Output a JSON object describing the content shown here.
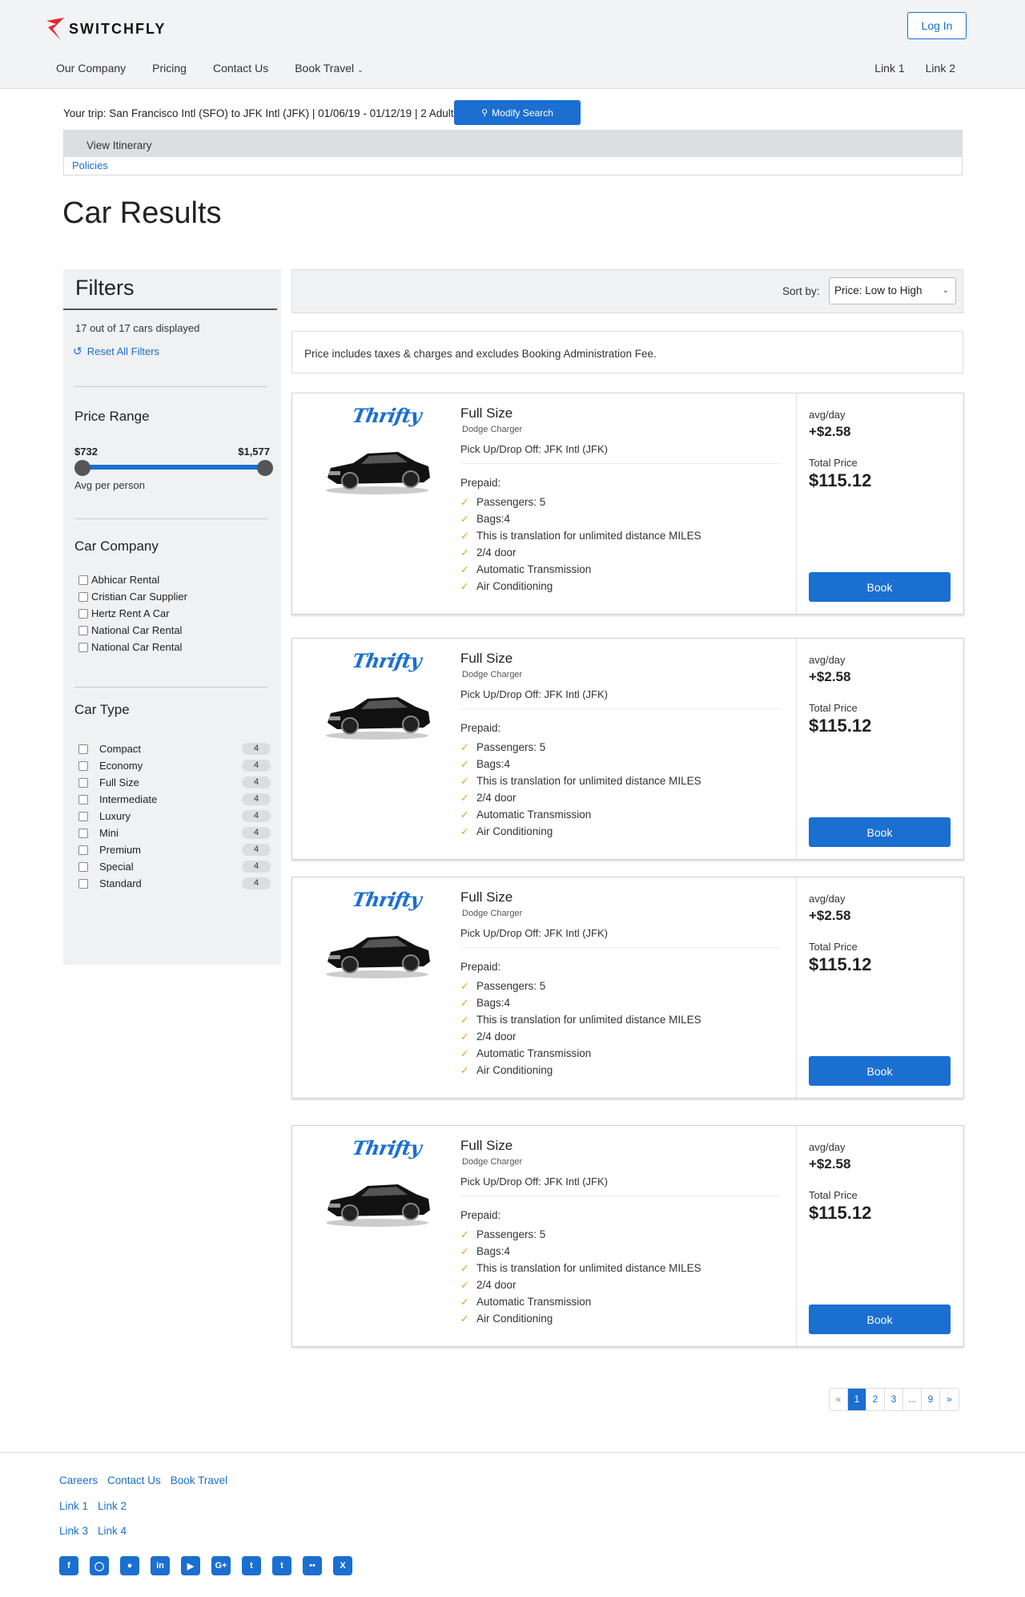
{
  "header": {
    "logo_text": "SWITCHFLY",
    "login_label": "Log In",
    "nav": [
      "Our Company",
      "Pricing",
      "Contact Us",
      "Book Travel"
    ],
    "nav_right": [
      "Link 1",
      "Link 2"
    ]
  },
  "trip": {
    "summary": "Your trip: San Francisco Intl (SFO) to JFK Intl (JFK) | 01/06/19 - 01/12/19 | 2 Adults",
    "modify_label": "Modify Search",
    "itinerary_label": "View Itinerary",
    "policies_label": "Policies"
  },
  "page_title": "Car Results",
  "filters": {
    "title": "Filters",
    "count": "17 out of 17 cars displayed",
    "reset": "Reset All Filters",
    "price_range": {
      "title": "Price Range",
      "min": "$732",
      "max": "$1,577",
      "note": "Avg per person"
    },
    "car_company": {
      "title": "Car Company",
      "items": [
        "Abhicar Rental",
        "Cristian Car Supplier",
        "Hertz Rent A Car",
        "National Car Rental",
        "National Car Rental"
      ]
    },
    "car_type": {
      "title": "Car Type",
      "items": [
        {
          "label": "Compact",
          "count": "4"
        },
        {
          "label": "Economy",
          "count": "4"
        },
        {
          "label": "Full Size",
          "count": "4"
        },
        {
          "label": "Intermediate",
          "count": "4"
        },
        {
          "label": "Luxury",
          "count": "4"
        },
        {
          "label": "Mini",
          "count": "4"
        },
        {
          "label": "Premium",
          "count": "4"
        },
        {
          "label": "Special",
          "count": "4"
        },
        {
          "label": "Standard",
          "count": "4"
        }
      ]
    }
  },
  "sort": {
    "label": "Sort by:",
    "selected": "Price: Low to High"
  },
  "price_note": "Price includes taxes & charges and excludes Booking Administration Fee.",
  "cars": [
    {
      "vendor": "Thrifty",
      "title": "Full Size",
      "model": "Dodge Charger",
      "pickup": "Pick Up/Drop Off: JFK Intl (JFK)",
      "prepaid": "Prepaid:",
      "features": [
        "Passengers: 5",
        "Bags:4",
        "This is translation for unlimited distance MILES",
        "2/4 door",
        "Automatic Transmission",
        "Air Conditioning"
      ],
      "avg_label": "avg/day",
      "avg_value": "+$2.58",
      "total_label": "Total Price",
      "total_value": "$115.12",
      "book_label": "Book"
    },
    {
      "vendor": "Thrifty",
      "title": "Full Size",
      "model": "Dodge Charger",
      "pickup": "Pick Up/Drop Off: JFK Intl (JFK)",
      "prepaid": "Prepaid:",
      "features": [
        "Passengers: 5",
        "Bags:4",
        "This is translation for unlimited distance MILES",
        "2/4 door",
        "Automatic Transmission",
        "Air Conditioning"
      ],
      "avg_label": "avg/day",
      "avg_value": "+$2.58",
      "total_label": "Total Price",
      "total_value": "$115.12",
      "book_label": "Book"
    },
    {
      "vendor": "Thrifty",
      "title": "Full Size",
      "model": "Dodge Charger",
      "pickup": "Pick Up/Drop Off: JFK Intl (JFK)",
      "prepaid": "Prepaid:",
      "features": [
        "Passengers: 5",
        "Bags:4",
        "This is translation for unlimited distance MILES",
        "2/4 door",
        "Automatic Transmission",
        "Air Conditioning"
      ],
      "avg_label": "avg/day",
      "avg_value": "+$2.58",
      "total_label": "Total Price",
      "total_value": "$115.12",
      "book_label": "Book"
    },
    {
      "vendor": "Thrifty",
      "title": "Full Size",
      "model": "Dodge Charger",
      "pickup": "Pick Up/Drop Off: JFK Intl (JFK)",
      "prepaid": "Prepaid:",
      "features": [
        "Passengers: 5",
        "Bags:4",
        "This is translation for unlimited distance MILES",
        "2/4 door",
        "Automatic Transmission",
        "Air Conditioning"
      ],
      "avg_label": "avg/day",
      "avg_value": "+$2.58",
      "total_label": "Total Price",
      "total_value": "$115.12",
      "book_label": "Book"
    }
  ],
  "pagination": [
    "«",
    "1",
    "2",
    "3",
    "...",
    "9",
    "»"
  ],
  "footer": {
    "row1": [
      "Careers",
      "Contact Us",
      "Book Travel"
    ],
    "row2": [
      "Link 1",
      "Link 2"
    ],
    "row3": [
      "Link 3",
      "Link 4"
    ],
    "social": [
      "facebook-icon",
      "instagram-icon",
      "github-icon",
      "linkedin-icon",
      "youtube-icon",
      "google-plus-icon",
      "twitter-icon",
      "tumblr-icon",
      "flickr-icon",
      "xing-icon"
    ]
  },
  "colors": {
    "accent": "#1a6fd0",
    "logo_red": "#e3262d",
    "check": "#f0a020"
  }
}
